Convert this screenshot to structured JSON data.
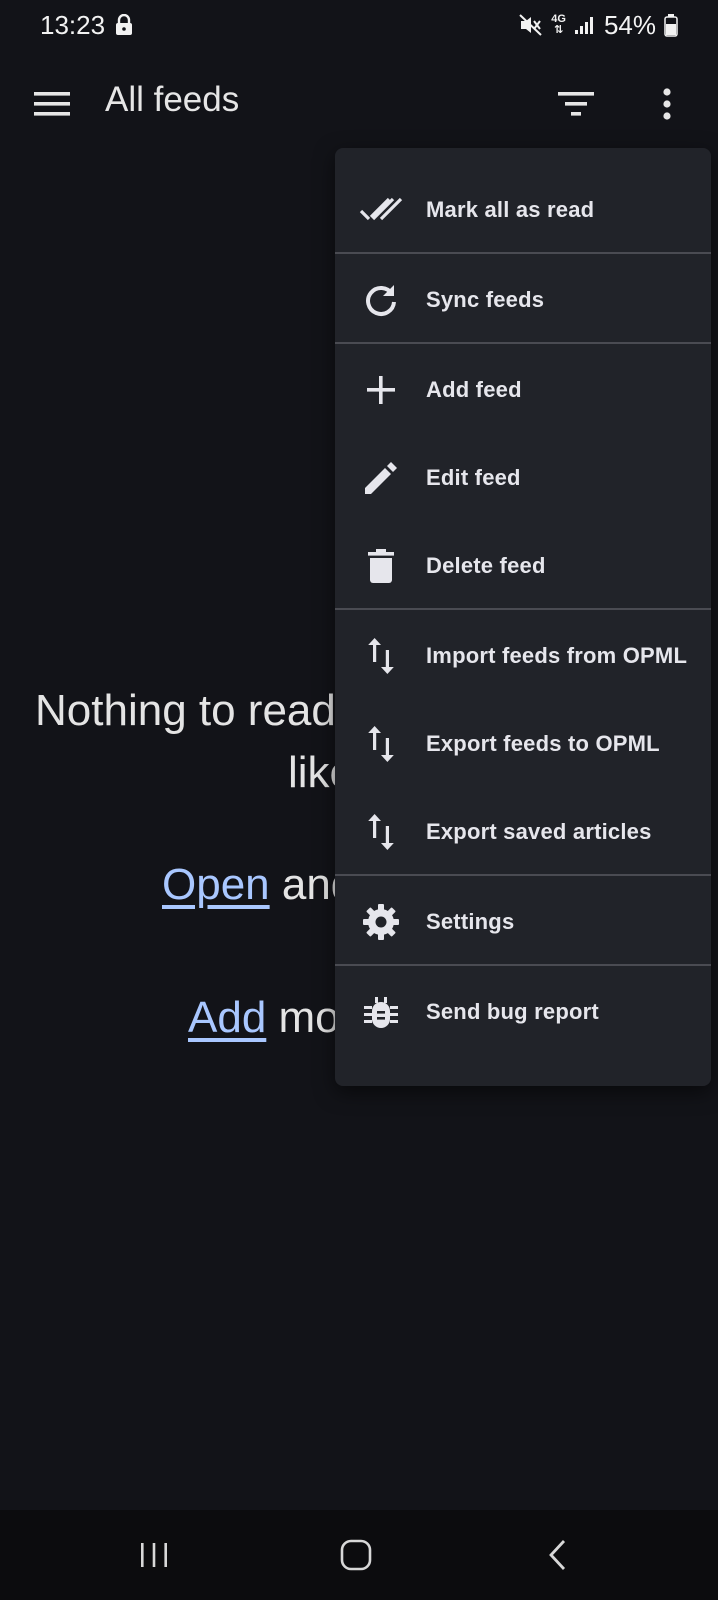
{
  "status_bar": {
    "time": "13:23",
    "network": "4G",
    "battery": "54%"
  },
  "app_bar": {
    "title": "All feeds"
  },
  "empty_state": {
    "line1": "Nothing to read",
    "line2": "like",
    "open_link": "Open",
    "open_rest": " and",
    "add_link": "Add",
    "add_rest": " mo"
  },
  "menu": {
    "items": [
      {
        "label": "Mark all as read",
        "icon": "done-all-icon"
      },
      {
        "label": "Sync feeds",
        "icon": "sync-icon"
      },
      {
        "label": "Add feed",
        "icon": "add-icon"
      },
      {
        "label": "Edit feed",
        "icon": "edit-icon"
      },
      {
        "label": "Delete feed",
        "icon": "delete-icon"
      },
      {
        "label": "Import feeds from OPML",
        "icon": "import-export-icon"
      },
      {
        "label": "Export feeds to OPML",
        "icon": "import-export-icon"
      },
      {
        "label": "Export saved articles",
        "icon": "import-export-icon"
      },
      {
        "label": "Settings",
        "icon": "gear-icon"
      },
      {
        "label": "Send bug report",
        "icon": "bug-icon"
      }
    ]
  },
  "colors": {
    "background": "#121318",
    "menu_background": "#212329",
    "link": "#a9c7ff",
    "text": "#e6e6ec"
  }
}
